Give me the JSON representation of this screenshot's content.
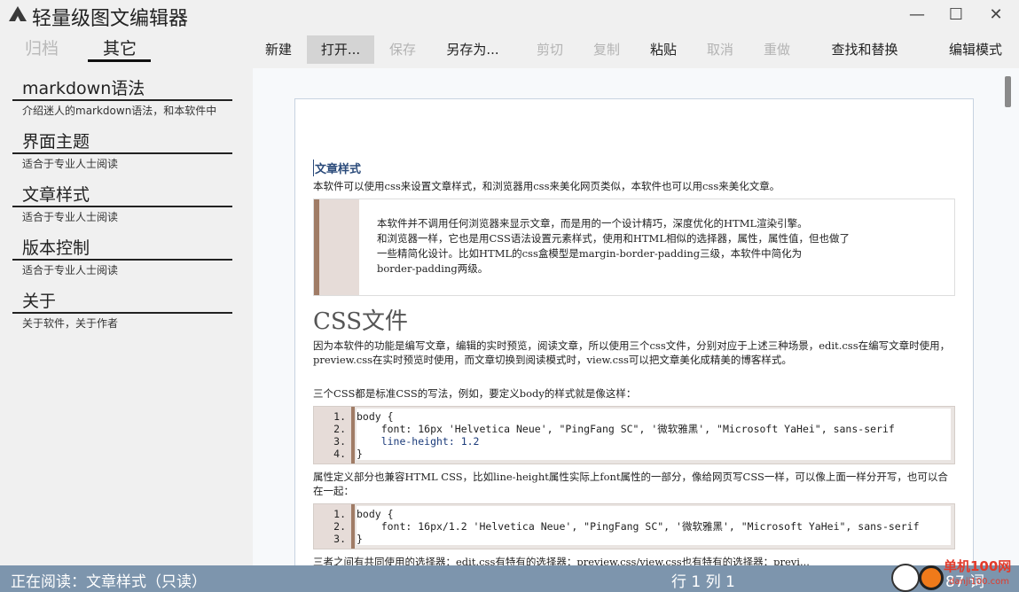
{
  "app": {
    "title": "轻量级图文编辑器"
  },
  "window_controls": {
    "minimize": "—",
    "maximize": "☐",
    "close": "✕"
  },
  "sidebar": {
    "tabs": [
      {
        "label": "归档",
        "active": false
      },
      {
        "label": "其它",
        "active": true
      }
    ],
    "items": [
      {
        "title": "markdown语法",
        "desc": "介绍迷人的markdown语法，和本软件中"
      },
      {
        "title": "界面主题",
        "desc": "适合于专业人士阅读"
      },
      {
        "title": "文章样式",
        "desc": "适合于专业人士阅读"
      },
      {
        "title": "版本控制",
        "desc": "适合于专业人士阅读"
      },
      {
        "title": "关于",
        "desc": "关于软件，关于作者"
      }
    ]
  },
  "toolbar": {
    "new": "新建",
    "open": "打开...",
    "save": "保存",
    "save_as": "另存为...",
    "cut": "剪切",
    "copy": "复制",
    "paste": "粘贴",
    "undo": "取消",
    "redo": "重做",
    "find_replace": "查找和替换",
    "edit_mode": "编辑模式"
  },
  "article": {
    "heading": "文章样式",
    "intro": "本软件可以使用css来设置文章样式，和浏览器用css来美化网页类似，本软件也可以用css来美化文章。",
    "quote": [
      "本软件并不调用任何浏览器来显示文章，而是用的一个设计精巧，深度优化的HTML渲染引擎。",
      "和浏览器一样，它也是用CSS语法设置元素样式，使用和HTML相似的选择器，属性，属性值，但也做了",
      "一些精简化设计。比如HTML的css盒模型是margin-border-padding三级，本软件中简化为",
      "border-padding两级。"
    ],
    "css_heading": "CSS文件",
    "css_para": "因为本软件的功能是编写文章，编辑的实时预览，阅读文章，所以使用三个css文件，分别对应于上述三种场景，edit.css在编写文章时使用，preview.css在实时预览时使用，而文章切换到阅读模式时，view.css可以把文章美化成精美的博客样式。",
    "css_para2": "三个CSS都是标准CSS的写法，例如，要定义body的样式就是像这样：",
    "code1": {
      "numbers": [
        "1.",
        "2.",
        "3.",
        "4."
      ],
      "lines": [
        "body {",
        "    font: 16px 'Helvetica Neue', \"PingFang SC\", '微软雅黑', \"Microsoft YaHei\", sans-serif",
        "    line-height: 1.2",
        "}"
      ]
    },
    "css_para3": "属性定义部分也兼容HTML CSS，比如line-height属性实际上font属性的一部分，像给网页写CSS一样，可以像上面一样分开写，也可以合在一起：",
    "code2": {
      "numbers": [
        "1.",
        "2.",
        "3."
      ],
      "lines": [
        "body {",
        "    font: 16px/1.2 'Helvetica Neue', \"PingFang SC\", '微软雅黑', \"Microsoft YaHei\", sans-serif",
        "}"
      ]
    },
    "tail": "三者之间有共同使用的选择器：edit.css有特有的选择器：preview.css/view.css也有特有的选择器：previ..."
  },
  "status": {
    "reading": "正在阅读：文章样式（只读）",
    "position": "行 1 列 1",
    "words": "87 词"
  },
  "watermark": {
    "text": "单机100网",
    "sub": "danji100.com"
  },
  "colors": {
    "statusbar": "#7d95ad",
    "quote_bar": "#a07c66",
    "heading_link": "#2a4a7a"
  }
}
